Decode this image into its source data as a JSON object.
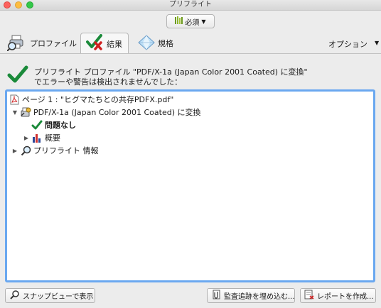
{
  "window": {
    "title": "プリフライト"
  },
  "toolbar": {
    "profile_dropdown_label": "必須"
  },
  "tabs": [
    {
      "label": "プロファイル",
      "icon": "printer-magnifier-icon"
    },
    {
      "label": "結果",
      "icon": "check-cross-icon",
      "selected": true
    },
    {
      "label": "規格",
      "icon": "diamond-icon"
    }
  ],
  "options_label": "オプション",
  "summary": {
    "line1": "プリフライト プロファイル \"PDF/X-1a (Japan Color 2001 Coated) に変換\"",
    "line2": "でエラーや警告は検出されませんでした："
  },
  "tree": {
    "page": "ページ 1 : \"ヒグマたちとの共存PDFX.pdf\"",
    "profile": "PDF/X-1a (Japan Color 2001 Coated) に変換",
    "no_problems": "問題なし",
    "overview": "概要",
    "preflight_info": "プリフライト 情報"
  },
  "buttons": {
    "snapshot": "スナップビューで表示",
    "audit": "監査追跡を埋め込む...",
    "report": "レポートを作成..."
  },
  "colors": {
    "check_green": "#1a8a3a",
    "cross_red": "#d02020",
    "focus_blue": "#6aa8f0"
  }
}
